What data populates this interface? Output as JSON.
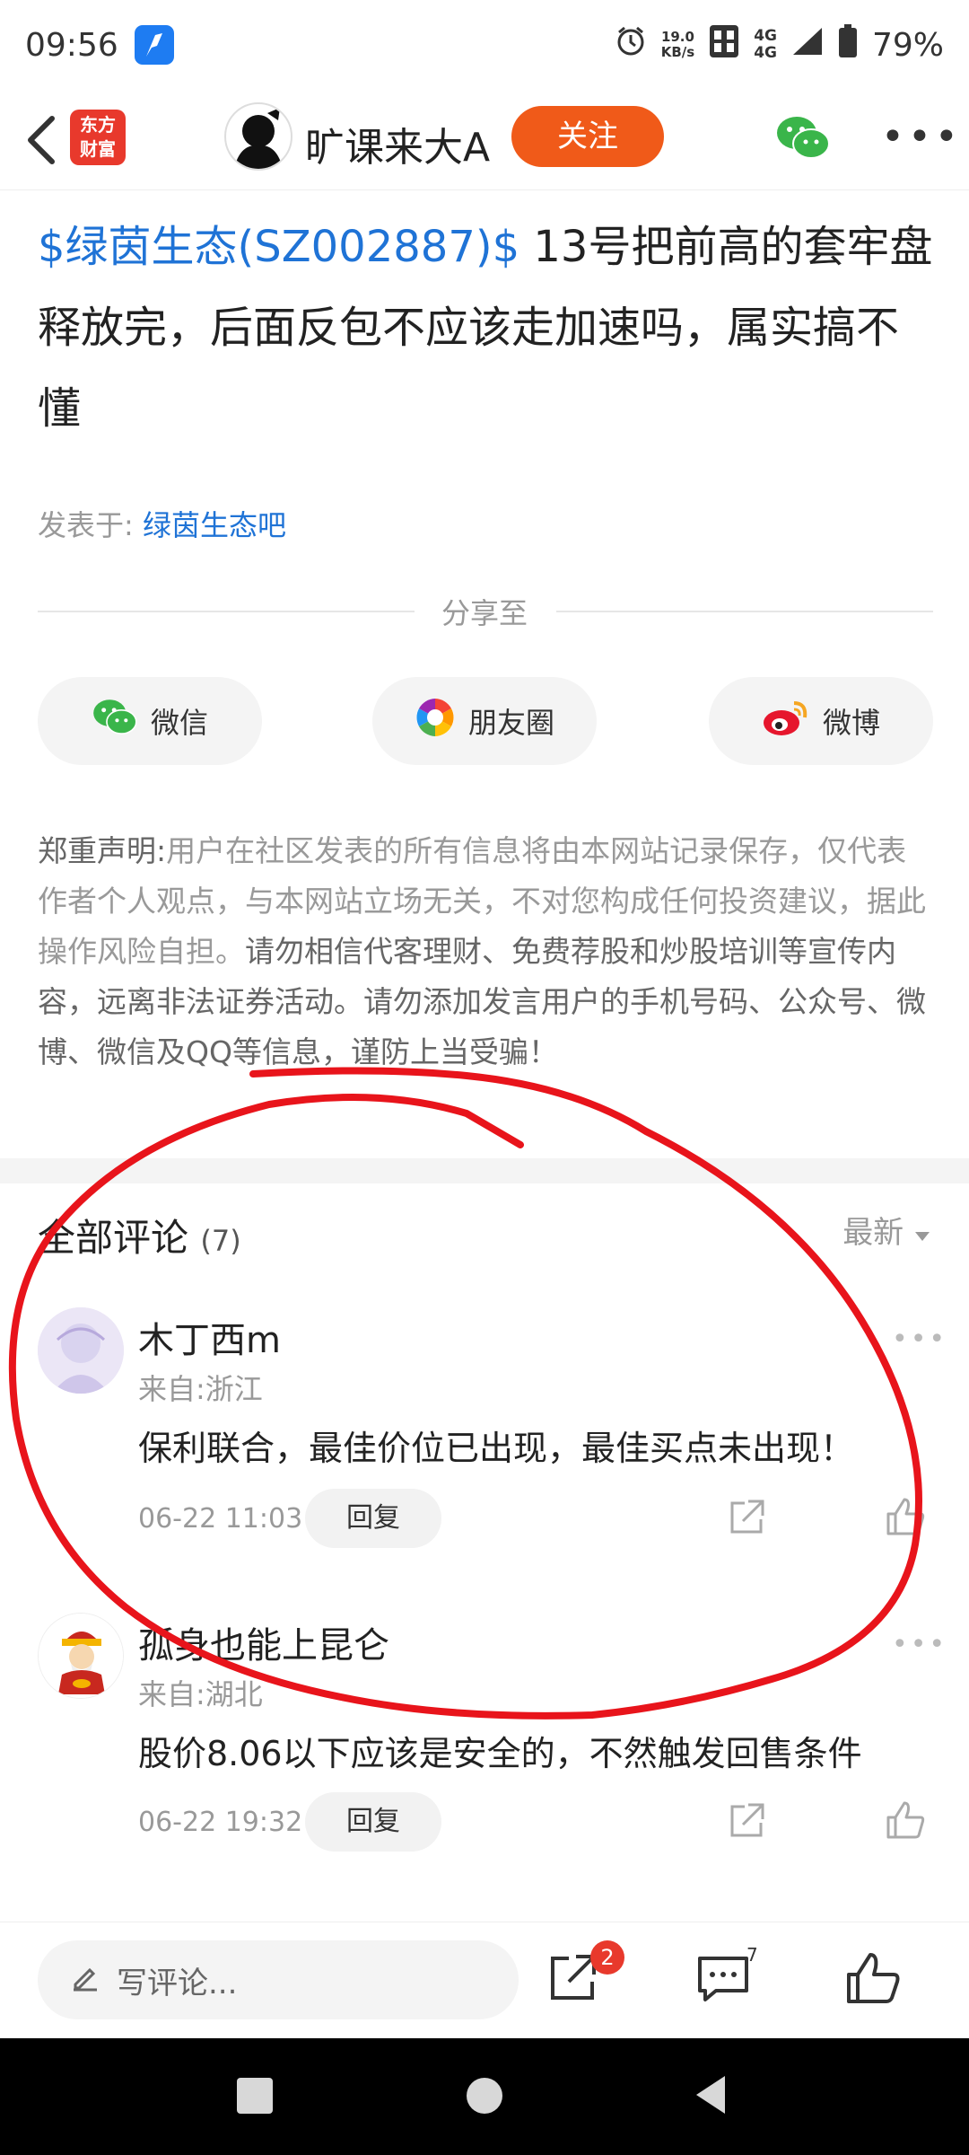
{
  "status_bar": {
    "time": "09:56",
    "speed_top": "19.0",
    "speed_bottom": "KB/s",
    "net_top": "4G",
    "net_bottom": "4G",
    "battery": "79%"
  },
  "header": {
    "logo_line1": "东方",
    "logo_line2": "财富",
    "author": "旷课来大A",
    "follow_label": "关注"
  },
  "post": {
    "stock_tag": "$绿茵生态(SZ002887)$",
    "text": " 13号把前高的套牢盘释放完，后面反包不应该走加速吗，属实搞不懂",
    "posted_in_label": "发表于:",
    "posted_in_bar": "绿茵生态吧"
  },
  "share": {
    "label": "分享至",
    "buttons": [
      "微信",
      "朋友圈",
      "微博"
    ]
  },
  "disclaimer": {
    "title": "郑重声明:",
    "part1": "用户在社区发表的所有信息将由本网站记录保存，仅代表作者个人观点，与本网站立场无关，不对您构成任何投资建议，据此操作风险自担。",
    "part2": "请勿相信代客理财、免费荐股和炒股培训等宣传内容，远离非法证券活动。请勿添加发言用户的手机号码、公众号、微博、微信及QQ等信息，谨防上当受骗！"
  },
  "comments_section": {
    "title": "全部评论",
    "count": "(7)",
    "sort_label": "最新",
    "items": [
      {
        "name": "木丁西m",
        "from": "来自:浙江",
        "text": "保利联合，最佳价位已出现，最佳买点未出现！",
        "time": "06-22 11:03",
        "reply_label": "回复"
      },
      {
        "name": "孤身也能上昆仑",
        "from": "来自:湖北",
        "text": "股价8.06以下应该是安全的，不然触发回售条件",
        "time": "06-22 19:32",
        "reply_label": "回复"
      }
    ]
  },
  "bottom_bar": {
    "write_placeholder": "写评论...",
    "share_badge": "2",
    "comment_count": "7"
  },
  "colors": {
    "accent_orange": "#f05a19",
    "link_blue": "#1f73d6",
    "annotation_red": "#e8141b"
  }
}
